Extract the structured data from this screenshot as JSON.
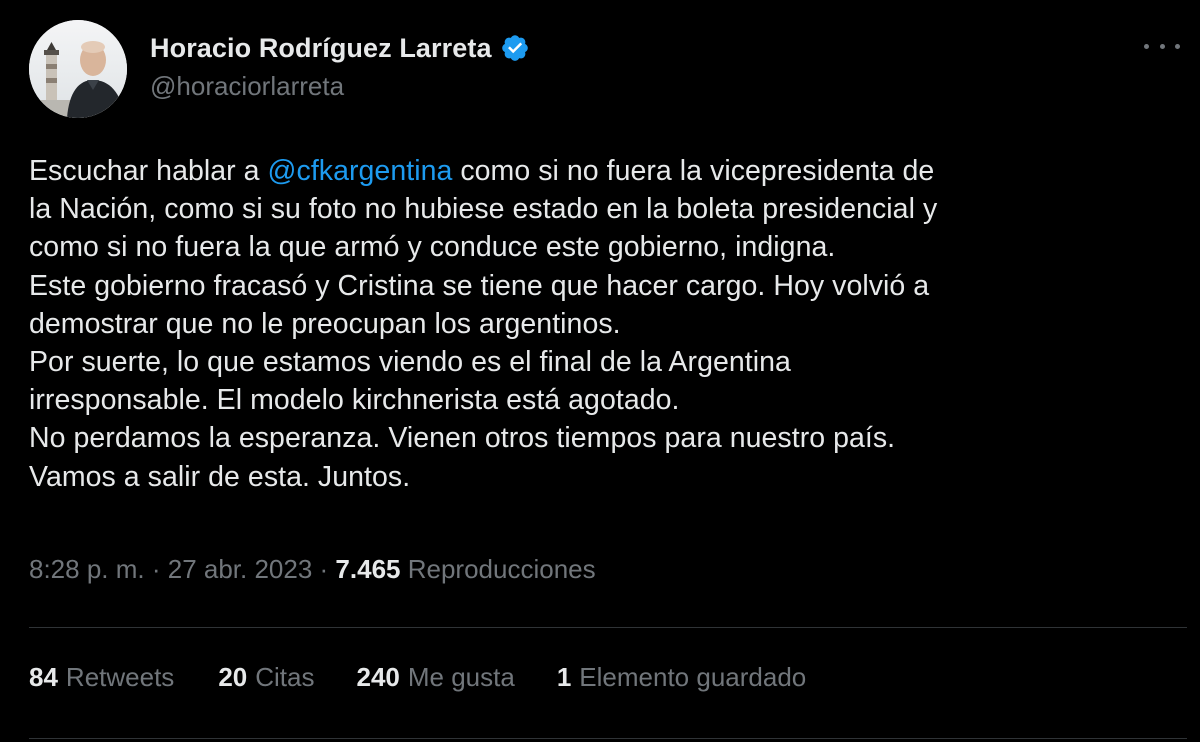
{
  "author": {
    "display_name": "Horacio Rodríguez Larreta",
    "handle": "@horaciorlarreta",
    "verified": true,
    "verified_color": "#1d9bf0"
  },
  "tweet": {
    "lines": [
      {
        "before": "Escuchar hablar a ",
        "mention": "@cfkargentina",
        "after": " como si no fuera la vicepresidenta de"
      },
      {
        "text": "la Nación, como si su foto no hubiese estado en la boleta presidencial y"
      },
      {
        "text": "como si no fuera la que armó y conduce este gobierno, indigna."
      },
      {
        "text": "Este gobierno fracasó y Cristina se tiene que hacer cargo. Hoy volvió a"
      },
      {
        "text": "demostrar que no le preocupan los argentinos."
      },
      {
        "text": "Por suerte, lo que estamos viendo es el final de la Argentina"
      },
      {
        "text": "irresponsable. El modelo kirchnerista está agotado."
      },
      {
        "text": "No perdamos la esperanza. Vienen otros tiempos para nuestro país."
      },
      {
        "text": "Vamos a salir de esta. Juntos."
      }
    ],
    "mention_color": "#1d9bf0"
  },
  "meta": {
    "time": "8:28 p. m.",
    "separator": " · ",
    "date": "27 abr. 2023",
    "views_count": "7.465",
    "views_label": "Reproducciones"
  },
  "stats": {
    "retweets": {
      "count": "84",
      "label": "Retweets"
    },
    "quotes": {
      "count": "20",
      "label": "Citas"
    },
    "likes": {
      "count": "240",
      "label": "Me gusta"
    },
    "bookmarks": {
      "count": "1",
      "label": "Elemento guardado"
    }
  },
  "icons": {
    "verified": "verified-badge-icon",
    "more": "more-options-icon"
  },
  "colors": {
    "background": "#000000",
    "text_primary": "#e7e9ea",
    "text_secondary": "#71767b",
    "divider": "#2f3336",
    "accent": "#1d9bf0"
  }
}
